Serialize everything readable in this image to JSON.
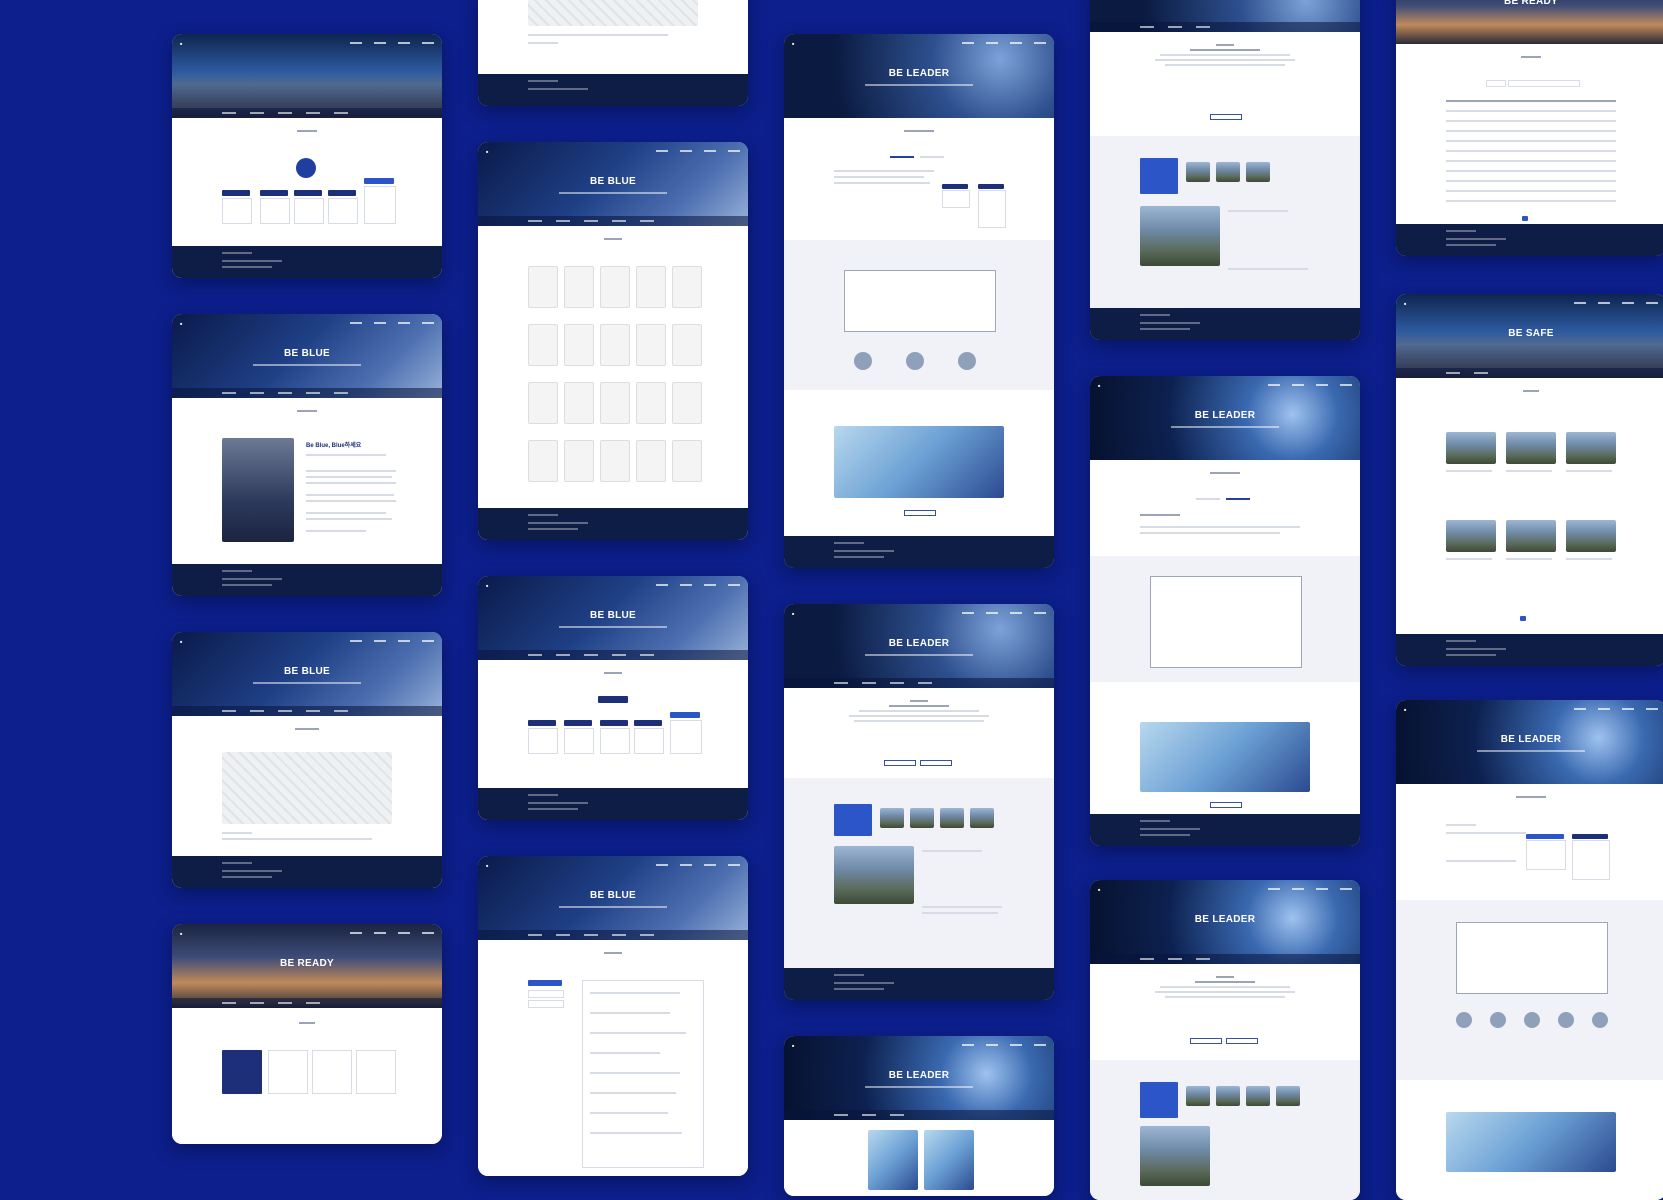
{
  "background_color": "#0c1f8c",
  "hero_titles": {
    "be_blue": "BE BLUE",
    "be_ready": "BE READY",
    "be_leader": "BE LEADER",
    "be_safe": "BE SAFE"
  },
  "ceo_heading": "Be Blue, Blue하세요",
  "cards": [
    {
      "id": "c1",
      "hero": "",
      "kind": "org"
    },
    {
      "id": "c2",
      "hero": "BE BLUE",
      "kind": "ceo"
    },
    {
      "id": "c3",
      "hero": "BE BLUE",
      "kind": "map"
    },
    {
      "id": "c4",
      "hero": "BE READY",
      "kind": "biz"
    },
    {
      "id": "c5",
      "hero": "",
      "kind": "map-tail"
    },
    {
      "id": "c6",
      "hero": "BE BLUE",
      "kind": "certs"
    },
    {
      "id": "c7",
      "hero": "BE BLUE",
      "kind": "org2"
    },
    {
      "id": "c8",
      "hero": "BE BLUE",
      "kind": "history"
    },
    {
      "id": "c9",
      "hero": "BE LEADER",
      "kind": "tech-scr"
    },
    {
      "id": "c10",
      "hero": "BE LEADER",
      "kind": "biz-detail"
    },
    {
      "id": "c11",
      "hero": "BE LEADER",
      "kind": "tail"
    },
    {
      "id": "c12",
      "hero": "",
      "kind": "biz-top"
    },
    {
      "id": "c13",
      "hero": "BE LEADER",
      "kind": "hrsg"
    },
    {
      "id": "c14",
      "hero": "BE LEADER",
      "kind": "biz-list"
    },
    {
      "id": "c15",
      "hero": "BE READY",
      "kind": "board"
    },
    {
      "id": "c16",
      "hero": "BE SAFE",
      "kind": "gallery"
    },
    {
      "id": "c17",
      "hero": "BE LEADER",
      "kind": "cems"
    }
  ],
  "colors": {
    "navy": "#0e1d45",
    "accent": "#1c2f78",
    "white": "#ffffff"
  }
}
